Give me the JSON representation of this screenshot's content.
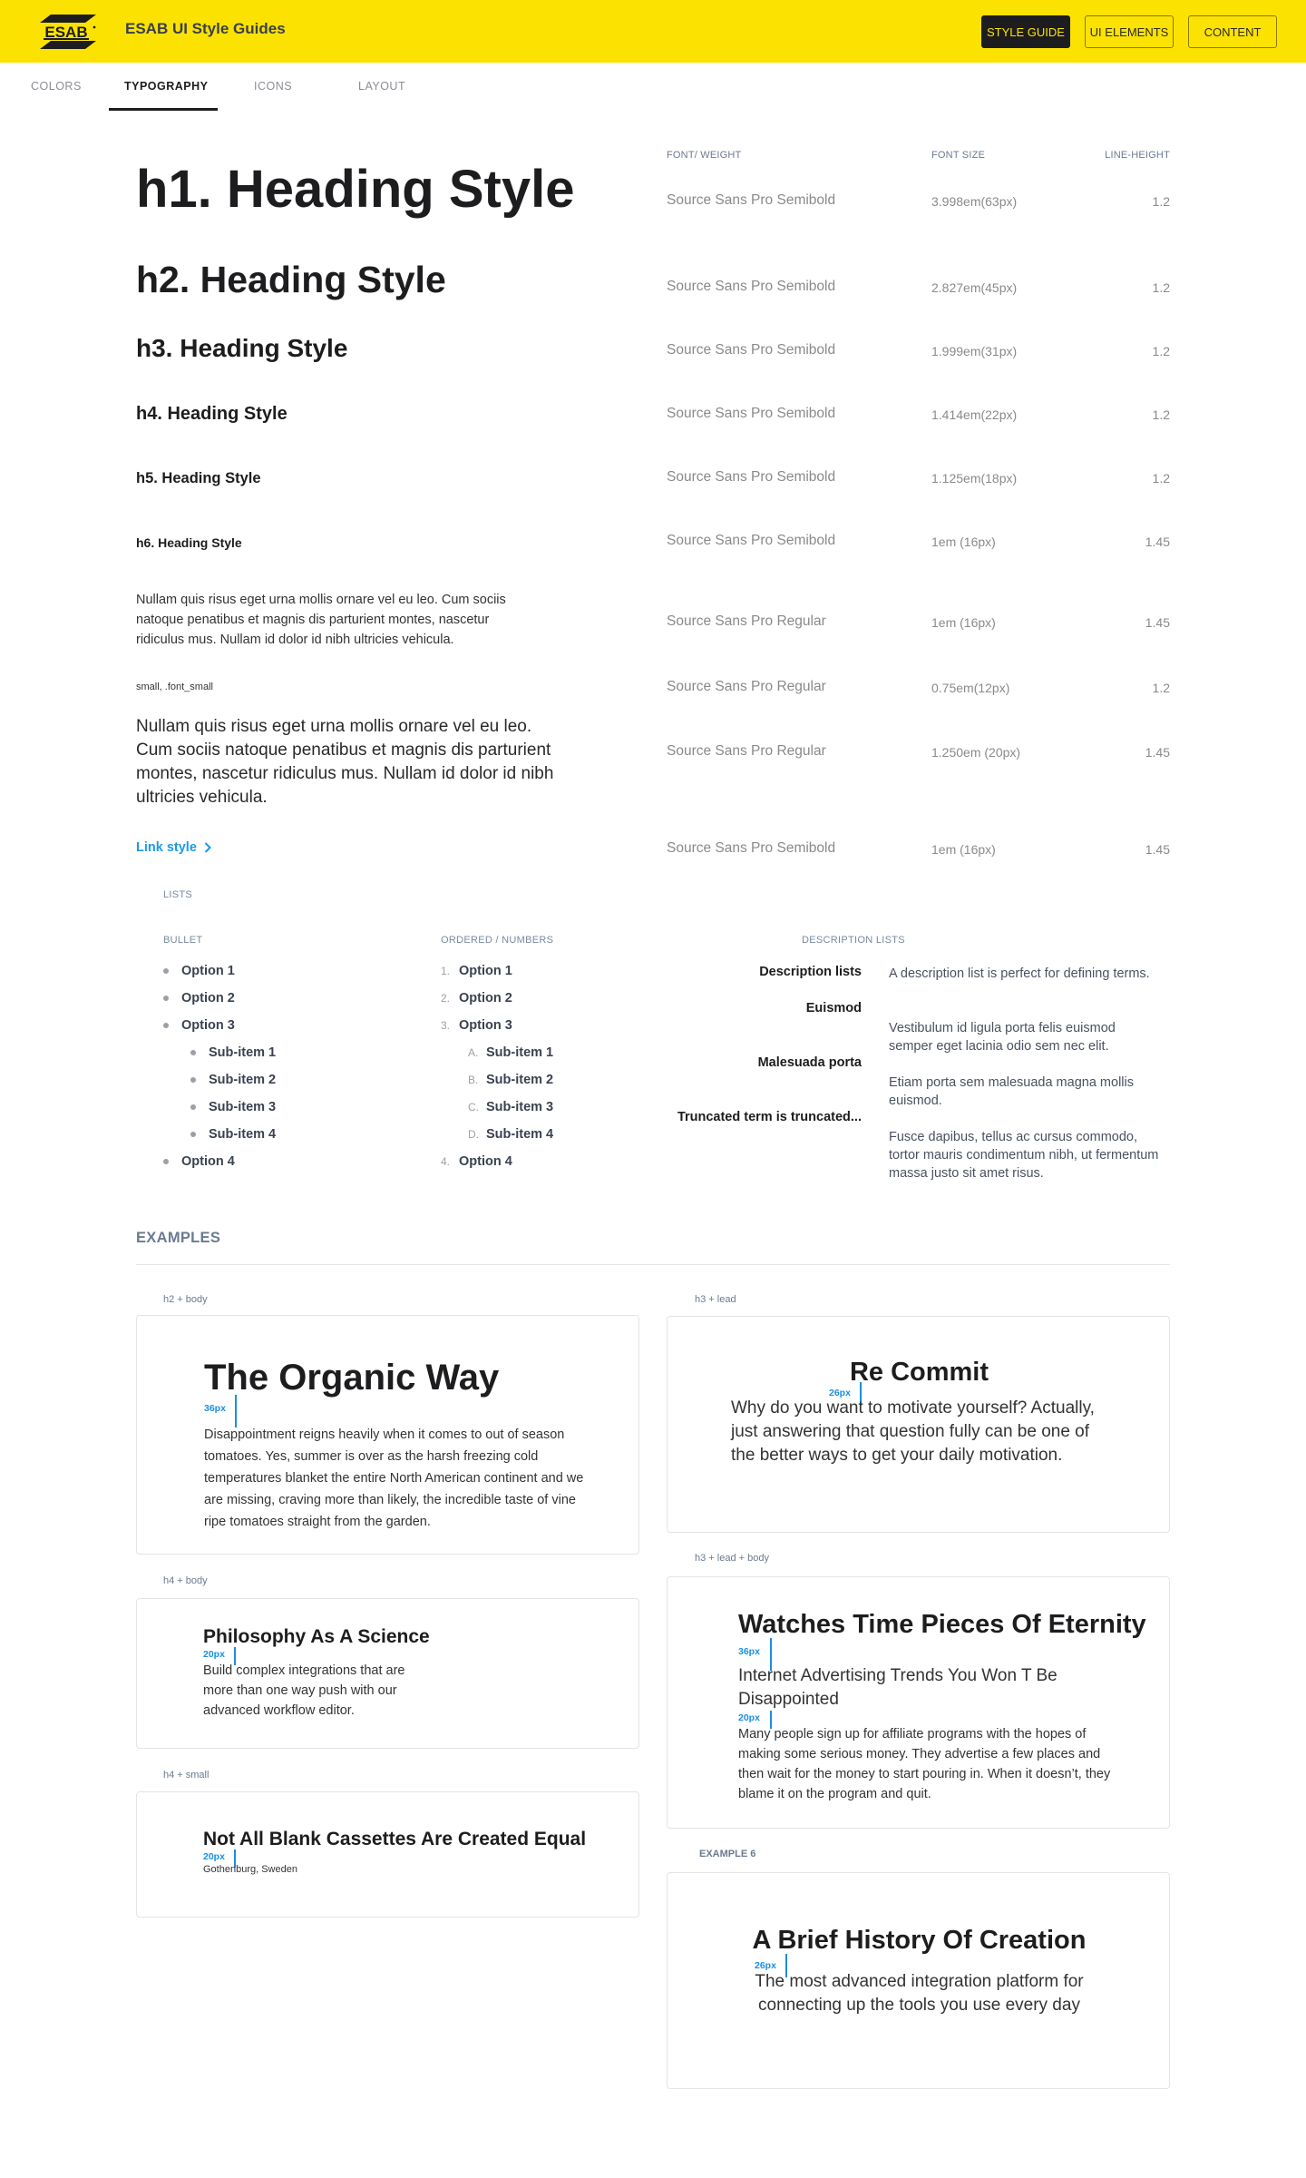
{
  "header": {
    "brand": "ESAB",
    "title": "ESAB UI Style Guides",
    "buttons": [
      {
        "label": "STYLE GUIDE",
        "active": true
      },
      {
        "label": "UI ELEMENTS",
        "active": false
      },
      {
        "label": "CONTENT",
        "active": false
      }
    ]
  },
  "tabs": [
    {
      "label": "COLORS",
      "active": false
    },
    {
      "label": "TYPOGRAPHY",
      "active": true
    },
    {
      "label": "ICONS",
      "active": false
    },
    {
      "label": "LAYOUT",
      "active": false
    }
  ],
  "type_table": {
    "headers": {
      "font": "FONT/ WEIGHT",
      "size": "FONT SIZE",
      "line_height": "LINE-HEIGHT"
    },
    "rows": [
      {
        "sample": "h1. Heading Style",
        "font": "Source Sans Pro Semibold",
        "size": "3.998em(63px)",
        "line_height": "1.2"
      },
      {
        "sample": "h2. Heading Style",
        "font": "Source Sans Pro Semibold",
        "size": "2.827em(45px)",
        "line_height": "1.2"
      },
      {
        "sample": "h3. Heading Style",
        "font": "Source Sans Pro Semibold",
        "size": "1.999em(31px)",
        "line_height": "1.2"
      },
      {
        "sample": "h4. Heading Style",
        "font": "Source Sans Pro Semibold",
        "size": "1.414em(22px)",
        "line_height": "1.2"
      },
      {
        "sample": "h5. Heading Style",
        "font": "Source Sans Pro Semibold",
        "size": "1.125em(18px)",
        "line_height": "1.2"
      },
      {
        "sample": "h6. Heading Style",
        "font": "Source Sans Pro Semibold",
        "size": "1em (16px)",
        "line_height": "1.45"
      },
      {
        "sample": "Nullam quis risus eget urna mollis ornare vel eu leo. Cum sociis natoque penatibus et magnis dis parturient montes, nascetur ridiculus mus. Nullam id dolor id nibh ultricies vehicula.",
        "font": "Source Sans Pro Regular",
        "size": "1em (16px)",
        "line_height": "1.45"
      },
      {
        "sample": "small, .font_small",
        "font": "Source Sans Pro Regular",
        "size": "0.75em(12px)",
        "line_height": "1.2"
      },
      {
        "sample": "Nullam quis risus eget urna mollis ornare vel eu leo. Cum sociis natoque penatibus et magnis dis parturient montes, nascetur ridiculus mus. Nullam id dolor id nibh ultricies vehicula.",
        "font": "Source Sans Pro Regular",
        "size": "1.250em (20px)",
        "line_height": "1.45"
      },
      {
        "sample": "Link style",
        "font": "Source Sans Pro Semibold",
        "size": "1em (16px)",
        "line_height": "1.45"
      }
    ]
  },
  "lists": {
    "title": "LISTS",
    "bullet": {
      "label": "BULLET",
      "items": [
        "Option 1",
        "Option 2",
        "Option 3",
        "Sub-item 1",
        "Sub-item 2",
        "Sub-item 3",
        "Sub-item 4",
        "Option 4"
      ]
    },
    "ordered": {
      "label": "ORDERED / NUMBERS",
      "markers": [
        "1.",
        "2.",
        "3.",
        "A.",
        "B.",
        "C.",
        "D.",
        "4."
      ],
      "items": [
        "Option 1",
        "Option 2",
        "Option 3",
        "Sub-item 1",
        "Sub-item 2",
        "Sub-item 3",
        "Sub-item 4",
        "Option 4"
      ]
    },
    "description": {
      "label": "DESCRIPTION LISTS",
      "terms": [
        "Description lists",
        "Euismod",
        "Malesuada porta",
        "Truncated term is truncated..."
      ],
      "definitions": [
        "A description list is perfect for defining terms.",
        "Vestibulum id ligula porta felis euismod semper eget lacinia odio sem nec elit.",
        "Etiam porta sem malesuada magna mollis euismod.",
        "Fusce dapibus, tellus ac cursus commodo, tortor mauris condimentum nibh, ut fermentum massa justo sit amet risus."
      ]
    }
  },
  "examples": {
    "title": "EXAMPLES",
    "accent_color": "#1a8ee0",
    "cards": [
      {
        "label": "h2 + body",
        "title": "The Organic Way",
        "spacing": "36px",
        "body": "Disappointment reigns heavily when it comes to out of season tomatoes. Yes, summer is over as the harsh freezing cold temperatures blanket the entire North American continent and we are missing, craving more than likely, the incredible taste of vine ripe tomatoes straight from the garden."
      },
      {
        "label": "h3 + lead",
        "title": "Re Commit",
        "spacing": "26px",
        "body": "Why do you want to motivate yourself? Actually, just answering that question fully can be one of the better ways to get your daily motivation."
      },
      {
        "label": "h4 + body",
        "title": "Philosophy As A Science",
        "spacing": "20px",
        "body": "Build complex integrations that are more than one way push with our advanced workflow editor."
      },
      {
        "label": "h3 + lead + body",
        "title": "Watches Time Pieces Of Eternity",
        "spacing": "36px",
        "lead": "Internet Advertising Trends You Won T Be Disappointed",
        "spacing2": "20px",
        "body": "Many people sign up for affiliate programs with the hopes of making some serious money. They advertise a few places and then wait for the money to start pouring in. When it doesn’t, they blame it on the program and quit."
      },
      {
        "label": "h4 + small",
        "title": "Not All Blank Cassettes Are Created Equal",
        "spacing": "20px",
        "body": "Gothenburg, Sweden"
      },
      {
        "label": "EXAMPLE 6",
        "title": "A Brief History Of Creation",
        "spacing": "26px",
        "body": "The most advanced integration platform for connecting up the tools you use every day"
      }
    ]
  }
}
